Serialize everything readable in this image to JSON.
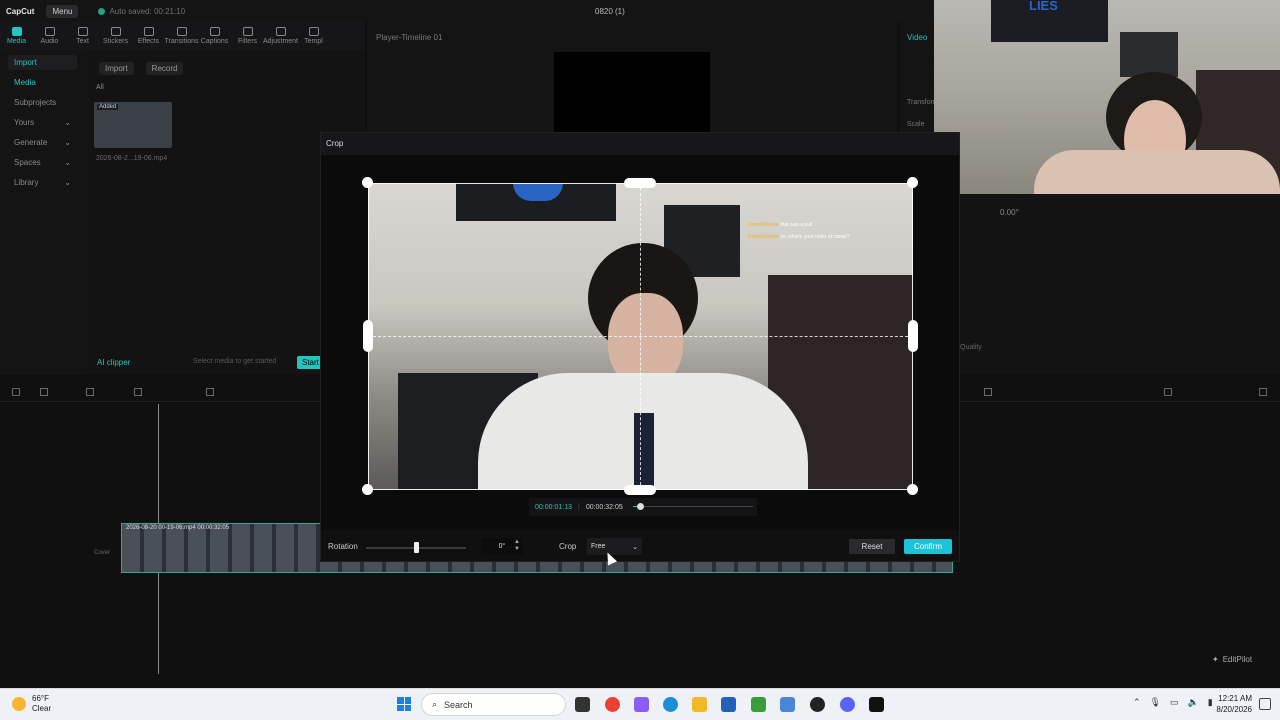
{
  "app": {
    "logo": "CapCut",
    "menu_label": "Menu",
    "autosave": "Auto saved: 00:21:10",
    "project_title": "0820 (1)"
  },
  "toolbar": {
    "items": [
      "Media",
      "Audio",
      "Text",
      "Stickers",
      "Effects",
      "Transitions",
      "Captions",
      "Filters",
      "Adjustment",
      "Templ"
    ]
  },
  "sidebar": {
    "items": [
      "Import",
      "Media",
      "Subprojects",
      "Yours",
      "Generate",
      "Spaces",
      "Library"
    ]
  },
  "media": {
    "import_label": "Import",
    "record_label": "Record",
    "all_label": "All",
    "thumb_added": "Added",
    "thumb_name": "2026-08-2...19-06.mp4",
    "ai_clipper": "AI clipper",
    "hint": "Select media to get started",
    "start_label": "Start"
  },
  "player": {
    "title": "Player-Timeline 01",
    "right_tab": "Video",
    "transform_label": "Transform",
    "scale_label": "Scale",
    "angle": "0.00°",
    "quality_label": "Quality"
  },
  "webcam": {
    "poster_text": "LIES"
  },
  "timeline": {
    "clip_label": "2026-08-20 00-19-06.mp4    00:00:32:05",
    "cover_label": "Cover",
    "editpilot": "EditPilot"
  },
  "crop": {
    "title": "Crop",
    "chat_user_1": "DrumlinGame",
    "chat_msg_1": "that was a pull",
    "chat_user_2": "DrumlinGame",
    "chat_msg_2": "yo, what's your order at canes?",
    "time_current": "00:00:01:13",
    "time_sep": "|",
    "time_total": "00:00:32:05",
    "rotation_label": "Rotation",
    "rotation_value": "0°",
    "crop_label": "Crop",
    "crop_ratio": "Free",
    "reset_label": "Reset",
    "confirm_label": "Confirm"
  },
  "taskbar": {
    "temp": "66°F",
    "condition": "Clear",
    "search_label": "Search",
    "time": "12:21 AM",
    "date": "8/20/2026"
  },
  "colors": {
    "accent": "#23c4c1",
    "confirm": "#1cc3d6",
    "bg": "#0f0f10"
  }
}
